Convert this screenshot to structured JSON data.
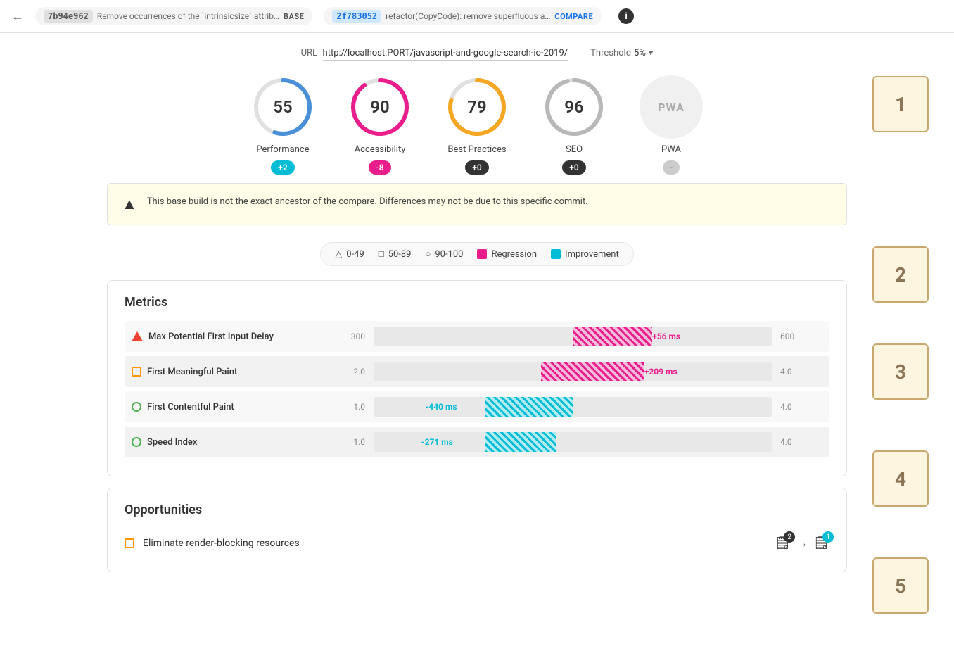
{
  "header": {
    "back_label": "←",
    "base_hash": "7b94e962",
    "base_description": "Remove occurrences of the `intrinsicsize` attrib…",
    "base_tag": "BASE",
    "compare_hash": "2f783052",
    "compare_description": "refactor(CopyCode): remove superfluous a…",
    "compare_tag": "COMPARE",
    "info_icon": "i"
  },
  "url_bar": {
    "url_label": "URL",
    "url_value": "http://localhost:PORT/javascript-and-google-search-io-2019/",
    "threshold_label": "Threshold",
    "threshold_value": "5%"
  },
  "scores": [
    {
      "id": "performance",
      "label": "Performance",
      "value": 55,
      "badge": "+2",
      "badge_class": "badge-cyan",
      "arc_color": "#4a90d9",
      "arc_percent": 55
    },
    {
      "id": "accessibility",
      "label": "Accessibility",
      "value": 90,
      "badge": "-8",
      "badge_class": "badge-pink",
      "arc_color": "#e91e8c",
      "arc_percent": 90
    },
    {
      "id": "best-practices",
      "label": "Best Practices",
      "value": 79,
      "badge": "+0",
      "badge_class": "badge-dark",
      "arc_color": "#f5a623",
      "arc_percent": 79
    },
    {
      "id": "seo",
      "label": "SEO",
      "value": 96,
      "badge": "+0",
      "badge_class": "badge-dark",
      "arc_color": "#b8b8b8",
      "arc_percent": 96
    }
  ],
  "pwa": {
    "label": "PWA",
    "display": "PWA",
    "badge": "-",
    "badge_class": "badge-neutral"
  },
  "warning": {
    "icon": "▲",
    "text": "This base build is not the exact ancestor of the compare. Differences may not be due to this specific commit."
  },
  "legend": {
    "items": [
      {
        "icon": "△",
        "label": "0-49"
      },
      {
        "icon": "□",
        "label": "50-89"
      },
      {
        "icon": "○",
        "label": "90-100"
      },
      {
        "swatch": "#e91e8c",
        "label": "Regression"
      },
      {
        "swatch": "#00bcd4",
        "label": "Improvement"
      }
    ]
  },
  "metrics": {
    "title": "Metrics",
    "rows": [
      {
        "id": "max-potential-fid",
        "icon_type": "triangle",
        "name": "Max Potential First Input Delay",
        "min": "300",
        "max": "600",
        "change": "+56 ms",
        "change_type": "regression",
        "bar_left_pct": 50,
        "bar_width_pct": 20
      },
      {
        "id": "first-meaningful-paint",
        "icon_type": "square",
        "name": "First Meaningful Paint",
        "min": "2.0",
        "max": "4.0",
        "change": "+209 ms",
        "change_type": "regression",
        "bar_left_pct": 45,
        "bar_width_pct": 25
      },
      {
        "id": "first-contentful-paint",
        "icon_type": "circle",
        "name": "First Contentful Paint",
        "min": "1.0",
        "max": "4.0",
        "change": "-440 ms",
        "change_type": "improvement",
        "bar_left_pct": 30,
        "bar_width_pct": 22
      },
      {
        "id": "speed-index",
        "icon_type": "circle",
        "name": "Speed Index",
        "min": "1.0",
        "max": "4.0",
        "change": "-271 ms",
        "change_type": "improvement",
        "bar_left_pct": 30,
        "bar_width_pct": 18
      }
    ]
  },
  "opportunities": {
    "title": "Opportunities",
    "rows": [
      {
        "id": "eliminate-render-blocking",
        "icon_type": "square",
        "name": "Eliminate render-blocking resources",
        "base_count": 2,
        "compare_count": 1
      }
    ]
  },
  "annotations": [
    {
      "id": "1",
      "label": "1"
    },
    {
      "id": "2",
      "label": "2"
    },
    {
      "id": "3",
      "label": "3"
    },
    {
      "id": "4",
      "label": "4"
    },
    {
      "id": "5",
      "label": "5"
    }
  ]
}
